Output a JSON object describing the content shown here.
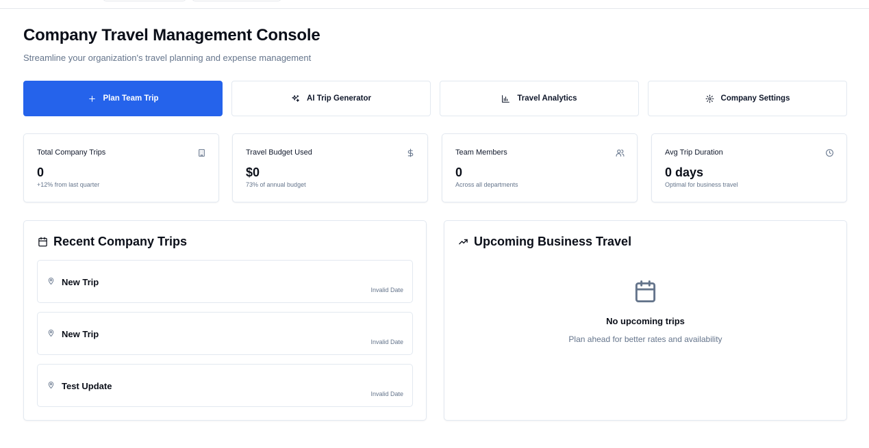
{
  "page": {
    "title": "Company Travel Management Console",
    "subtitle": "Streamline your organization's travel planning and expense management"
  },
  "actions": [
    {
      "label": "Plan Team Trip",
      "icon": "plus-icon"
    },
    {
      "label": "AI Trip Generator",
      "icon": "sparkles-icon"
    },
    {
      "label": "Travel Analytics",
      "icon": "bar-chart-icon"
    },
    {
      "label": "Company Settings",
      "icon": "gear-icon"
    }
  ],
  "stats": [
    {
      "label": "Total Company Trips",
      "value": "0",
      "note": "+12% from last quarter",
      "icon": "building-icon"
    },
    {
      "label": "Travel Budget Used",
      "value": "$0",
      "note": "73% of annual budget",
      "icon": "dollar-icon"
    },
    {
      "label": "Team Members",
      "value": "0",
      "note": "Across all departments",
      "icon": "users-icon"
    },
    {
      "label": "Avg Trip Duration",
      "value": "0 days",
      "note": "Optimal for business travel",
      "icon": "clock-icon"
    }
  ],
  "recent": {
    "title": "Recent Company Trips",
    "icon": "calendar-icon",
    "trips": [
      {
        "name": "New Trip",
        "date": "Invalid Date"
      },
      {
        "name": "New Trip",
        "date": "Invalid Date"
      },
      {
        "name": "Test Update",
        "date": "Invalid Date"
      }
    ]
  },
  "upcoming": {
    "title": "Upcoming Business Travel",
    "icon": "trending-up-icon",
    "empty_title": "No upcoming trips",
    "empty_subtitle": "Plan ahead for better rates and availability"
  },
  "colors": {
    "primary": "#2563eb",
    "muted_text": "#64748b",
    "border": "#e2e8f0"
  }
}
